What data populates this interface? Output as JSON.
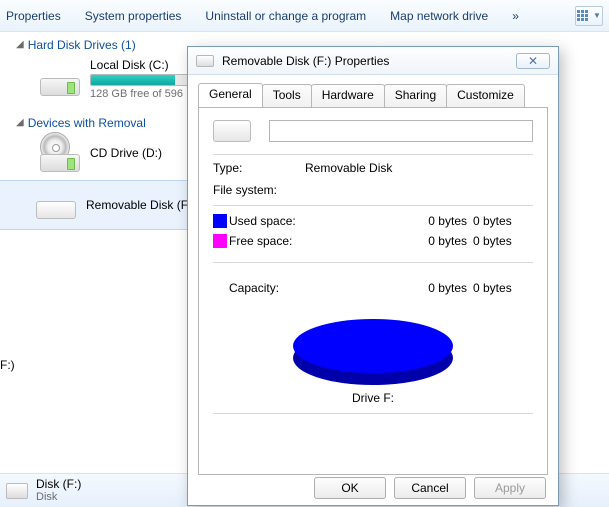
{
  "toolbar": {
    "properties": "Properties",
    "system_properties": "System properties",
    "uninstall": "Uninstall or change a program",
    "map_drive": "Map network drive",
    "chevron": "»"
  },
  "sections": {
    "hdd_header": "Hard Disk Drives (1)",
    "devices_header": "Devices with Removal"
  },
  "drives": {
    "local": {
      "name": "Local Disk (C:)",
      "sub": "128 GB free of 596",
      "fill_percent": 78
    },
    "cd": {
      "name": "CD Drive (D:)"
    },
    "removable": {
      "name": "Removable Disk (F"
    }
  },
  "nav_hint": "F:)",
  "status": {
    "line1": "Disk (F:)",
    "line2": "Disk"
  },
  "dialog": {
    "title": "Removable Disk (F:) Properties",
    "tabs": {
      "general": "General",
      "tools": "Tools",
      "hardware": "Hardware",
      "sharing": "Sharing",
      "customize": "Customize"
    },
    "type_label": "Type:",
    "type_value": "Removable Disk",
    "fs_label": "File system:",
    "used_label": "Used space:",
    "free_label": "Free space:",
    "capacity_label": "Capacity:",
    "zero_bytes": "0 bytes",
    "drive_label": "Drive F:",
    "volume_name": "",
    "buttons": {
      "ok": "OK",
      "cancel": "Cancel",
      "apply": "Apply"
    }
  },
  "chart_data": {
    "type": "pie",
    "title": "Drive F:",
    "series": [
      {
        "name": "Used space",
        "value": 0,
        "unit": "bytes",
        "color": "#0000ff"
      },
      {
        "name": "Free space",
        "value": 0,
        "unit": "bytes",
        "color": "#ff00ff"
      }
    ],
    "capacity": {
      "value": 0,
      "unit": "bytes"
    }
  }
}
